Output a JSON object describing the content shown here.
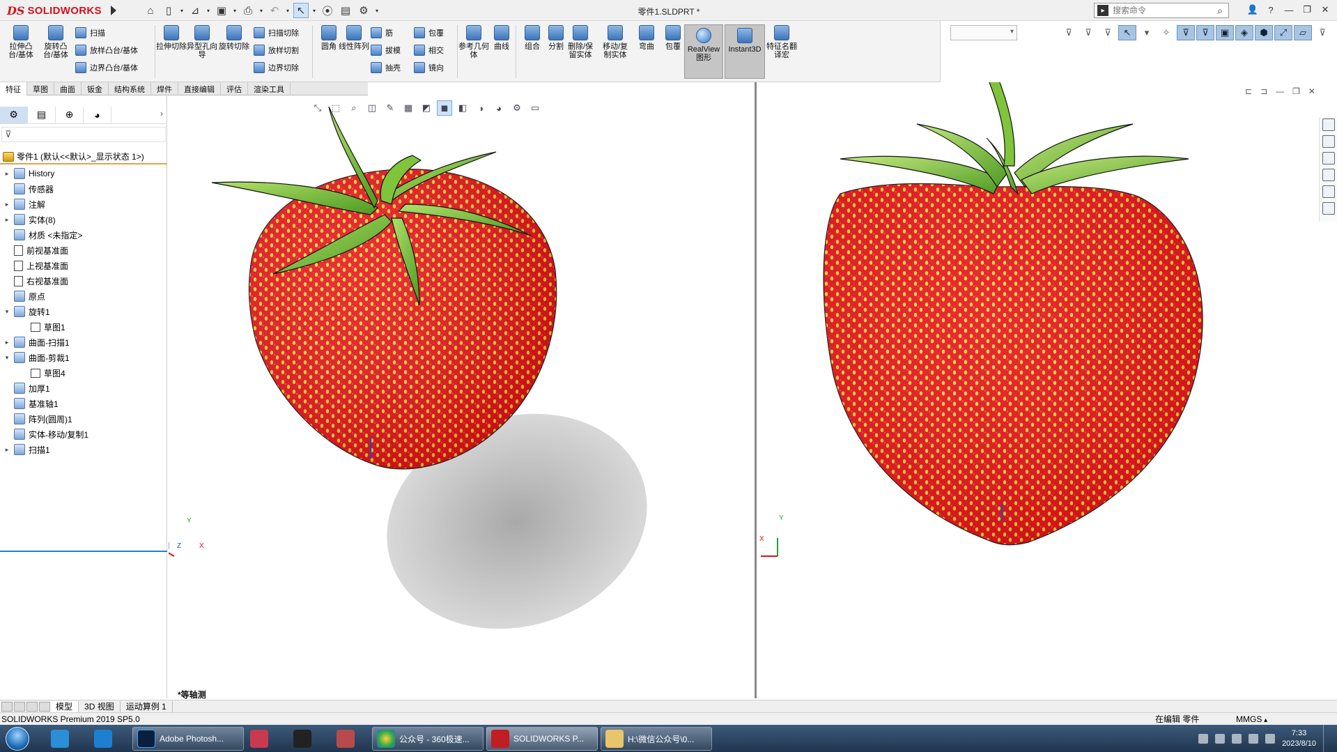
{
  "app": {
    "logo_prefix": "DS",
    "logo_text": "SOLIDWORKS",
    "doc_title": "零件1.SLDPRT *",
    "search_placeholder": "搜索命令"
  },
  "ribbon": {
    "tools": [
      {
        "id": "extrude-boss",
        "label": "拉伸凸台/基体"
      },
      {
        "id": "revolve-boss",
        "label": "旋转凸台/基体"
      },
      {
        "id": "sweep",
        "label": "扫描"
      },
      {
        "id": "loft-boss",
        "label": "放样凸台/基体"
      },
      {
        "id": "boundary-boss",
        "label": "边界凸台/基体"
      },
      {
        "id": "extrude-cut",
        "label": "拉伸切除"
      },
      {
        "id": "hole-wizard",
        "label": "异型孔向导"
      },
      {
        "id": "revolve-cut",
        "label": "旋转切除"
      },
      {
        "id": "swept-cut",
        "label": "扫描切除"
      },
      {
        "id": "lofted-cut",
        "label": "放样切割"
      },
      {
        "id": "boundary-cut",
        "label": "边界切除"
      },
      {
        "id": "fillet",
        "label": "圆角"
      },
      {
        "id": "linear-pattern",
        "label": "线性阵列"
      },
      {
        "id": "rib",
        "label": "筋"
      },
      {
        "id": "draft",
        "label": "拔模"
      },
      {
        "id": "shell",
        "label": "抽壳"
      },
      {
        "id": "wrap",
        "label": "包覆"
      },
      {
        "id": "intersect",
        "label": "相交"
      },
      {
        "id": "mirror",
        "label": "镜向"
      },
      {
        "id": "ref-geometry",
        "label": "参考几何体"
      },
      {
        "id": "curves",
        "label": "曲线"
      },
      {
        "id": "combine",
        "label": "组合"
      },
      {
        "id": "split",
        "label": "分割"
      },
      {
        "id": "delete-keep",
        "label": "删除/保留实体"
      },
      {
        "id": "move-copy",
        "label": "移动/复制实体"
      },
      {
        "id": "flex",
        "label": "弯曲"
      },
      {
        "id": "wrap2",
        "label": "包覆"
      },
      {
        "id": "realview",
        "label": "RealView 图形"
      },
      {
        "id": "instant3d",
        "label": "Instant3D"
      },
      {
        "id": "feature-translate",
        "label": "特征名翻译宏"
      }
    ],
    "tabs": [
      "特征",
      "草图",
      "曲面",
      "钣金",
      "结构系统",
      "焊件",
      "直接编辑",
      "评估",
      "渲染工具"
    ]
  },
  "feature_tree": {
    "root": "零件1 (默认<<默认>_显示状态 1>)",
    "items": [
      {
        "label": "History",
        "twisty": "▸"
      },
      {
        "label": "传感器",
        "twisty": ""
      },
      {
        "label": "注解",
        "twisty": "▸"
      },
      {
        "label": "实体(8)",
        "twisty": "▸"
      },
      {
        "label": "材质 <未指定>",
        "twisty": ""
      },
      {
        "label": "前视基准面",
        "twisty": ""
      },
      {
        "label": "上视基准面",
        "twisty": ""
      },
      {
        "label": "右视基准面",
        "twisty": ""
      },
      {
        "label": "原点",
        "twisty": ""
      },
      {
        "label": "旋转1",
        "twisty": "▾"
      },
      {
        "label": "草图1",
        "twisty": ""
      },
      {
        "label": "曲面-扫描1",
        "twisty": "▸"
      },
      {
        "label": "曲面-剪裁1",
        "twisty": "▾"
      },
      {
        "label": "草图4",
        "twisty": ""
      },
      {
        "label": "加厚1",
        "twisty": ""
      },
      {
        "label": "基准轴1",
        "twisty": ""
      },
      {
        "label": "阵列(圆周)1",
        "twisty": ""
      },
      {
        "label": "实体-移动/复制1",
        "twisty": ""
      },
      {
        "label": "扫描1",
        "twisty": "▸"
      }
    ]
  },
  "viewport": {
    "left_view_label": "*等轴测",
    "axis_x": "X",
    "axis_y": "Y",
    "axis_z": "Z"
  },
  "bottom_tabs": [
    "模型",
    "3D 视图",
    "运动算例 1"
  ],
  "status": {
    "product": "SOLIDWORKS Premium 2019 SP5.0",
    "editing": "在编辑 零件",
    "units": "MMGS"
  },
  "taskbar": {
    "windows": [
      {
        "label": "Adobe Photosh..."
      },
      {
        "label": "公众号 - 360极速..."
      },
      {
        "label": "SOLIDWORKS P..."
      },
      {
        "label": "H:\\微信公众号\\0..."
      }
    ],
    "time": "7:33",
    "date": "2023/8/10"
  },
  "colors": {
    "strawberry_red": "#e8121b",
    "seed_yellow": "#f3e22a",
    "leaf_green": "#6fb82d",
    "brand_red": "#d6101a"
  }
}
